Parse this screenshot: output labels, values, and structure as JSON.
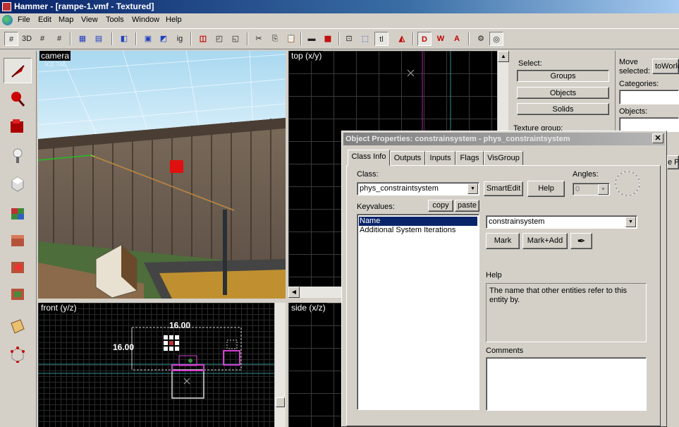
{
  "window": {
    "title": "Hammer - [rampe-1.vmf - Textured]"
  },
  "menu": [
    "File",
    "Edit",
    "Map",
    "View",
    "Tools",
    "Window",
    "Help"
  ],
  "toolbar_icons": [
    "grid-icon",
    "grid-3d-icon",
    "grid-small-icon",
    "grid-large-icon",
    "carve-icon",
    "group-icon",
    "ungroup-icon",
    "ignore-group-icon",
    "hide-icon",
    "show-icon",
    "cordon-icon",
    "cut-icon",
    "copy-icon",
    "paste-icon",
    "texture-lock-icon",
    "texture-app-icon",
    "snap-icon",
    "select-icon",
    "toggle-icon",
    "run-map-icon",
    "decals-icon",
    "overlays-icon",
    "wrap-icon",
    "lock-icon",
    "help-icon"
  ],
  "toolbar_text": {
    "t3d": "3D",
    "ig": "ig",
    "tl": "tl",
    "d": "D",
    "w": "W",
    "a": "A"
  },
  "viewports": {
    "camera": "camera",
    "top": "top (x/y)",
    "front": "front (y/z)",
    "side": "side (x/z)",
    "front_dim_w": "16.00",
    "front_dim_h": "16.00"
  },
  "select_panel": {
    "label": "Select:",
    "groups": "Groups",
    "objects": "Objects",
    "solids": "Solids",
    "texture_group": "Texture group:"
  },
  "move_panel": {
    "label1": "Move",
    "label2": "selected:",
    "to_world": "toWorld",
    "categories": "Categories:",
    "objects": "Objects:",
    "partial_btn": "e Pr"
  },
  "dialog": {
    "title": "Object Properties: constrainsystem - phys_constraintsystem",
    "close": "✕",
    "tabs": [
      "Class Info",
      "Outputs",
      "Inputs",
      "Flags",
      "VisGroup"
    ],
    "class_label": "Class:",
    "class_value": "phys_constraintsystem",
    "smartedit": "SmartEdit",
    "help_btn": "Help",
    "angles_label": "Angles:",
    "angles_value": "0",
    "keyvalues_label": "Keyvalues:",
    "copy": "copy",
    "paste": "paste",
    "keyvalues": [
      "Name",
      "Additional System Iterations"
    ],
    "value_combo": "constrainsystem",
    "mark": "Mark",
    "mark_add": "Mark+Add",
    "help_label": "Help",
    "help_text": "The name that other entities refer to this entity by.",
    "comments_label": "Comments"
  }
}
